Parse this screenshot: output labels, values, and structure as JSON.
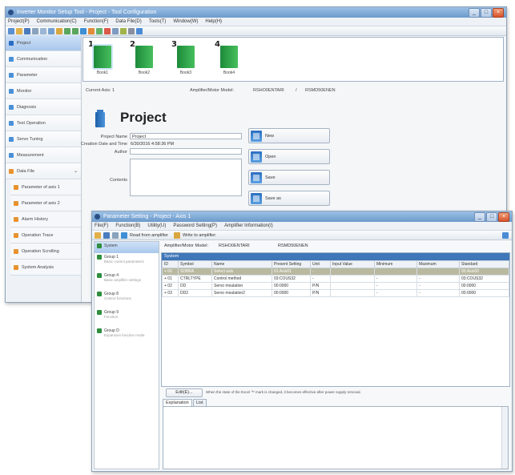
{
  "main_window": {
    "title": "Inverter Monitor Setup Tool - Project - Tool Configuration",
    "menu": [
      "Project(P)",
      "Communication(C)",
      "Function(F)",
      "Data File(D)",
      "Tools(T)",
      "Window(W)",
      "Help(H)"
    ],
    "sidebar": [
      {
        "label": "Project",
        "icon": "project-icon",
        "color": "#2a6cc2",
        "active": true
      },
      {
        "label": "Communication",
        "icon": "communication-icon",
        "color": "#4a90d9"
      },
      {
        "label": "Parameter",
        "icon": "parameter-icon",
        "color": "#4a90d9"
      },
      {
        "label": "Monitor",
        "icon": "monitor-icon",
        "color": "#4a90d9"
      },
      {
        "label": "Diagnosis",
        "icon": "diagnosis-icon",
        "color": "#4a90d9"
      },
      {
        "label": "Test Operation",
        "icon": "test-operation-icon",
        "color": "#4a90d9"
      },
      {
        "label": "Servo Tuning",
        "icon": "servo-tuning-icon",
        "color": "#4a90d9"
      },
      {
        "label": "Measurement",
        "icon": "measurement-icon",
        "color": "#4a90d9"
      },
      {
        "label": "Data File",
        "icon": "data-file-icon",
        "color": "#e8922e"
      },
      {
        "label": "Parameter of axis 1",
        "icon": "file-icon",
        "color": "#e8922e",
        "sub": true
      },
      {
        "label": "Parameter of axis 2",
        "icon": "file-icon",
        "color": "#e8922e",
        "sub": true
      },
      {
        "label": "Alarm History",
        "icon": "file-icon",
        "color": "#e8922e",
        "sub": true
      },
      {
        "label": "Operation Trace",
        "icon": "file-icon",
        "color": "#e8922e",
        "sub": true
      },
      {
        "label": "Operation Scrolling",
        "icon": "file-icon",
        "color": "#e8922e",
        "sub": true
      },
      {
        "label": "System Analysis",
        "icon": "file-icon",
        "color": "#e8922e",
        "sub": true
      }
    ],
    "steps": [
      {
        "num": "1",
        "label": "Book1",
        "current": true
      },
      {
        "num": "2",
        "label": "Book2"
      },
      {
        "num": "3",
        "label": "Book3"
      },
      {
        "num": "4",
        "label": "Book4"
      }
    ],
    "current_axis_label": "Current Axis: 1",
    "amplifier_label": "Amplifier/Motor Model:",
    "amplifier_value": "RSHO0ENTARI",
    "amplifier_sep": "/",
    "motor_value": "RSMD50ENEN",
    "project_title": "Project",
    "fields": {
      "name_label": "Project Name",
      "name_value": "Project",
      "date_label": "Creation Date and Time",
      "date_value": "6/30/2016 4:58:36 PM",
      "author_label": "Author",
      "author_value": "",
      "contents_label": "Contents",
      "contents_value": ""
    },
    "actions": [
      "New",
      "Open",
      "Save",
      "Save as"
    ]
  },
  "param_window": {
    "title": "Parameter Setting - Project - Axis 1",
    "menu": [
      "File(F)",
      "Function(B)",
      "Utility(U)",
      "Password Setting(P)",
      "Amplifier Information(I)"
    ],
    "toolbar_labels": [
      "Read from amplifier",
      "Write to amplifier"
    ],
    "sidebar": [
      {
        "title": "System",
        "sub": "",
        "active": true
      },
      {
        "title": "Group 1",
        "sub": "Basic control parameters"
      },
      {
        "title": "Group 4",
        "sub": "Basic amplifier settings"
      },
      {
        "title": "Group 8",
        "sub": "Control functions"
      },
      {
        "title": "Group 9",
        "sub": "Function"
      },
      {
        "title": "Group D",
        "sub": "Expansion function mode"
      }
    ],
    "amp_label": "Amplifier/Motor Model:",
    "amp_value": "RSHO0ENTARI",
    "motor_value": "RSMD50ENEN",
    "section_title": "System",
    "columns": [
      "ID",
      "Symbol",
      "Name",
      "Present Setting",
      "Unit",
      "Input Value",
      "Minimum",
      "Maximum",
      "Standard"
    ],
    "rows": [
      {
        "id": "+ 00",
        "symbol": "SDBRA",
        "name": "Select axis",
        "present": "01:Axis01",
        "unit": "-",
        "input": "",
        "min": "",
        "max": "",
        "std": "00:Axis00",
        "selected": true
      },
      {
        "id": "+ 01",
        "symbol": "CTRLTYPE",
        "name": "Control method",
        "present": "03:COUS32",
        "unit": "-",
        "input": "",
        "min": "-",
        "max": "-",
        "std": "03:COUS32"
      },
      {
        "id": "+ 02",
        "symbol": "DD",
        "name": "Servo moulation",
        "present": "00:0000",
        "unit": "P/N",
        "input": "",
        "min": "-",
        "max": "-",
        "std": "00:0000"
      },
      {
        "id": "+ 03",
        "symbol": "DD2",
        "name": "Servo moulation2",
        "present": "00:0000",
        "unit": "P/N",
        "input": "",
        "min": "-",
        "max": "-",
        "std": "00:0000"
      }
    ],
    "edit_button": "Edit(E)...",
    "note": "When the state of the Excel ™ mark is changed, it becomes effective after power supply removal.",
    "tabs": [
      "Explanation",
      "List"
    ]
  }
}
